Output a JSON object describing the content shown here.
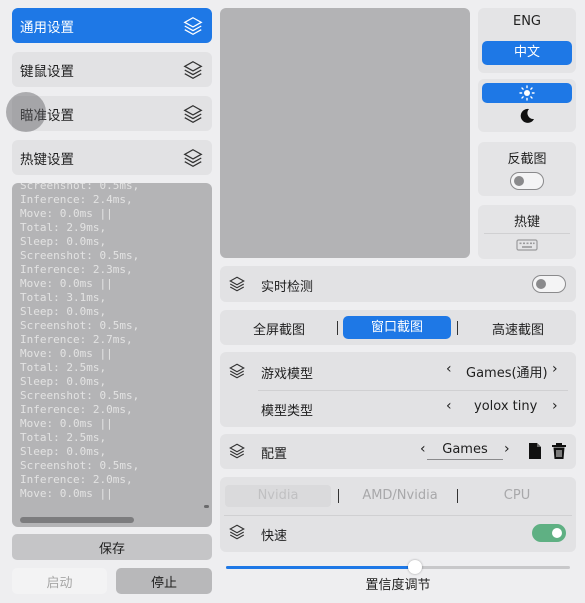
{
  "nav": {
    "items": [
      {
        "label": "通用设置",
        "active": true
      },
      {
        "label": "键鼠设置",
        "active": false
      },
      {
        "label": "瞄准设置",
        "active": false
      },
      {
        "label": "热键设置",
        "active": false
      }
    ]
  },
  "log": {
    "lines": "Screenshot: 0.5ms,\nInference: 2.4ms,\nMove: 0.0ms ||\nTotal: 2.9ms,\nSleep: 0.0ms,\nScreenshot: 0.5ms,\nInference: 2.3ms,\nMove: 0.0ms ||\nTotal: 3.1ms,\nSleep: 0.0ms,\nScreenshot: 0.5ms,\nInference: 2.7ms,\nMove: 0.0ms ||\nTotal: 2.5ms,\nSleep: 0.0ms,\nScreenshot: 0.5ms,\nInference: 2.0ms,\nMove: 0.0ms ||\nTotal: 2.5ms,\nSleep: 0.0ms,\nScreenshot: 0.5ms,\nInference: 2.0ms,\nMove: 0.0ms ||"
  },
  "actions": {
    "save": "保存",
    "start": "启动",
    "stop": "停止"
  },
  "language": {
    "eng": "ENG",
    "zh": "中文"
  },
  "reverse": {
    "title": "反截图"
  },
  "hotkey": {
    "title": "热键"
  },
  "realtime": {
    "label": "实时检测"
  },
  "capture": {
    "full": "全屏截图",
    "window": "窗口截图",
    "fast": "高速截图"
  },
  "model": {
    "game_label": "游戏模型",
    "game_value": "Games(通用)",
    "type_label": "模型类型",
    "type_value": "yolox tiny"
  },
  "config": {
    "label": "配置",
    "value": "Games"
  },
  "backend": {
    "nvidia": "Nvidia",
    "amd": "AMD/Nvidia",
    "cpu": "CPU"
  },
  "fast": {
    "label": "快速"
  },
  "confidence": {
    "label": "置信度调节",
    "value": 0.55
  },
  "colors": {
    "accent": "#1e78e6",
    "toggle_on": "#5fb083"
  }
}
